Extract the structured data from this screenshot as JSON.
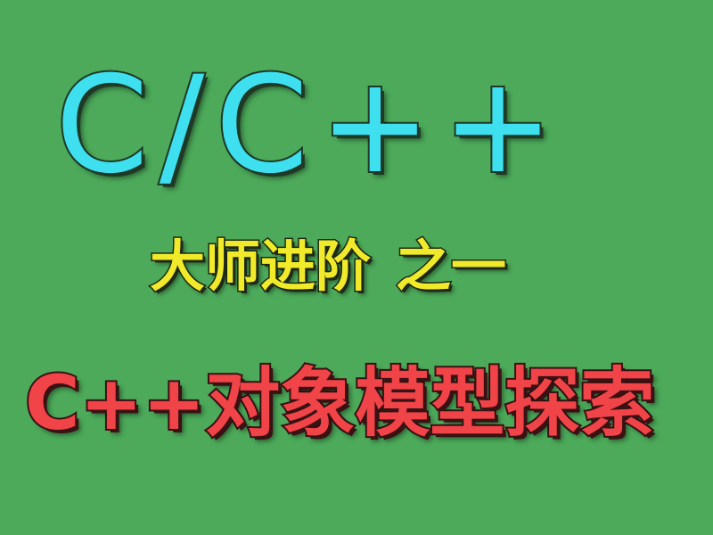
{
  "title": "C/C++",
  "subtitle_part1": "大师进阶",
  "subtitle_part2": "之一",
  "course_title": "C++对象模型探索",
  "colors": {
    "background": "#4caa5a",
    "title": "#3ee0f0",
    "subtitle": "#f0ea2a",
    "course_title": "#f04448"
  }
}
